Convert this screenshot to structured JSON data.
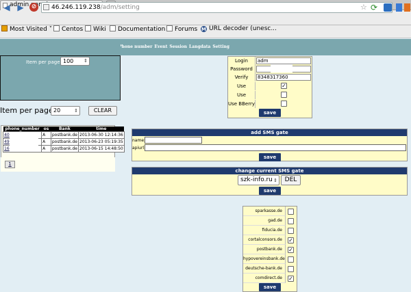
{
  "browser": {
    "tab_title": "admin panel",
    "new_tab": "+",
    "url_host": "46.246.119.238",
    "url_path": "/adm/setting",
    "bookmarks": [
      "Most Visited",
      "Centos",
      "Wiki",
      "Documentation",
      "Forums",
      "URL decoder (unesc..."
    ]
  },
  "top_menu": [
    "Phone number",
    "Event",
    "Session",
    "Langdata",
    "Setting"
  ],
  "items_per_page_1": {
    "label": "Item per page:",
    "value": "100"
  },
  "items_per_page_2": {
    "label": "Item per page:",
    "value": "20"
  },
  "clear_button": "CLEAR",
  "table": {
    "headers": [
      "phone_number",
      "os",
      "Bank",
      "time"
    ],
    "rows": [
      {
        "phone": "40",
        "os": "A",
        "bank": "postbank.de",
        "time": "2013-06-30 12:14:36"
      },
      {
        "phone": "49",
        "os": "A",
        "bank": "postbank.de",
        "time": "2013-06-23 05:19:35"
      },
      {
        "phone": "16",
        "os": "A",
        "bank": "postbank.de",
        "time": "2013-06-15 14:48:50"
      }
    ],
    "page": "1"
  },
  "settings": {
    "login_label": "Login",
    "login_value": "adm",
    "password_label": "Password",
    "verify_label": "Verify Code",
    "verify_value": "8348317360",
    "use_android": "Use Android",
    "use_symbian": "Use Symbian",
    "use_bberry": "Use BBerry",
    "android_checked": true,
    "symbian_checked": false,
    "bberry_checked": false,
    "save": "save"
  },
  "add_gate": {
    "title": "add SMS gate",
    "name_label": "name:",
    "apiurl_label": "apiurl:",
    "save": "save"
  },
  "change_gate": {
    "title": "change current SMS gate",
    "selected": "szk-info.ru",
    "del": "DEL",
    "save": "save"
  },
  "banks": {
    "items": [
      {
        "name": "sparkasse.de",
        "checked": false
      },
      {
        "name": "gad.de",
        "checked": false
      },
      {
        "name": "fiducia.de",
        "checked": false
      },
      {
        "name": "cortalconsors.de",
        "checked": true
      },
      {
        "name": "postbank.de",
        "checked": true
      },
      {
        "name": "hypovereinsbank.de",
        "checked": false
      },
      {
        "name": "deutsche-bank.de",
        "checked": false
      },
      {
        "name": "comdirect.de",
        "checked": true
      }
    ],
    "save": "save"
  }
}
